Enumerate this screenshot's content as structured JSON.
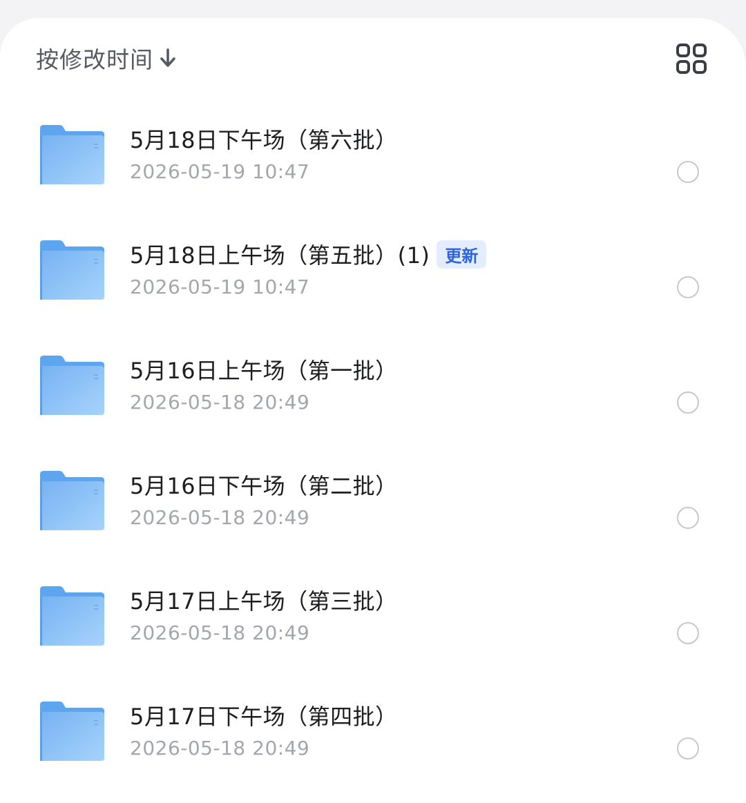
{
  "toolbar": {
    "sort_label": "按修改时间",
    "sort_icon": "arrow-down-icon",
    "view_icon": "grid-view-icon"
  },
  "colors": {
    "folder": "#7fb9f4",
    "badge_background": "#e4edfd",
    "badge_text": "#2a64e4"
  },
  "files": [
    {
      "name": "5月18日下午场（第六批）",
      "time": "2026-05-19 10:47",
      "badge": null,
      "selected": false
    },
    {
      "name": "5月18日上午场（第五批）(1)",
      "time": "2026-05-19 10:47",
      "badge": "更新",
      "selected": false
    },
    {
      "name": "5月16日上午场（第一批）",
      "time": "2026-05-18 20:49",
      "badge": null,
      "selected": false
    },
    {
      "name": "5月16日下午场（第二批）",
      "time": "2026-05-18 20:49",
      "badge": null,
      "selected": false
    },
    {
      "name": "5月17日上午场（第三批）",
      "time": "2026-05-18 20:49",
      "badge": null,
      "selected": false
    },
    {
      "name": "5月17日下午场（第四批）",
      "time": "2026-05-18 20:49",
      "badge": null,
      "selected": false
    }
  ]
}
